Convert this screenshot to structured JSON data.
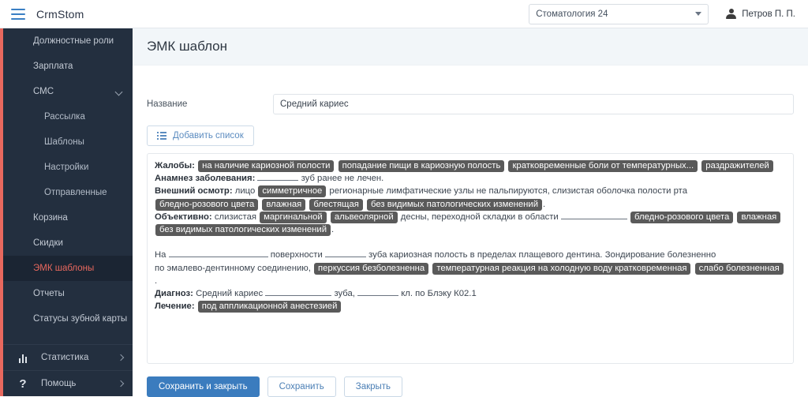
{
  "topbar": {
    "menu_icon": "hamburger-icon",
    "brand": "CrmStom",
    "clinic": {
      "selected": "Стоматология 24",
      "caret_icon": "chevron-down-icon"
    },
    "user": {
      "icon": "user-avatar-icon",
      "name": "Петров П. П."
    }
  },
  "sidebar": {
    "accent_color": "#e8685e",
    "background_color": "#232f3f",
    "items": [
      {
        "label": "Должностные роли",
        "sub": false,
        "active": false,
        "expandable": false
      },
      {
        "label": "Зарплата",
        "sub": false,
        "active": false,
        "expandable": false
      },
      {
        "label": "СМС",
        "sub": false,
        "active": false,
        "expandable": true
      },
      {
        "label": "Рассылка",
        "sub": true,
        "active": false,
        "expandable": false
      },
      {
        "label": "Шаблоны",
        "sub": true,
        "active": false,
        "expandable": false
      },
      {
        "label": "Настройки",
        "sub": true,
        "active": false,
        "expandable": false
      },
      {
        "label": "Отправленные",
        "sub": true,
        "active": false,
        "expandable": false
      },
      {
        "label": "Корзина",
        "sub": false,
        "active": false,
        "expandable": false
      },
      {
        "label": "Скидки",
        "sub": false,
        "active": false,
        "expandable": false
      },
      {
        "label": "ЭМК шаблоны",
        "sub": false,
        "active": true,
        "expandable": false
      },
      {
        "label": "Отчеты",
        "sub": false,
        "active": false,
        "expandable": false
      },
      {
        "label": "Статусы зубной карты",
        "sub": false,
        "active": false,
        "expandable": false
      }
    ],
    "footer_items": [
      {
        "label": "Статистика",
        "icon": "bar-chart-icon",
        "arrow_icon": "chevron-right-icon"
      },
      {
        "label": "Помощь",
        "icon": "question-mark-icon",
        "arrow_icon": "chevron-right-icon"
      }
    ]
  },
  "main": {
    "page_title": "ЭМК шаблон",
    "form": {
      "name_label": "Название",
      "name_value": "Средний кариес",
      "name_placeholder": ""
    },
    "add_list_button": {
      "label": "Добавить список",
      "icon": "list-icon"
    },
    "editor": {
      "lines": [
        {
          "id": "zhaloby",
          "parts": [
            {
              "type": "bold",
              "text": "Жалобы:"
            },
            {
              "type": "tag",
              "text": "на наличие кариозной полости"
            },
            {
              "type": "tag",
              "text": "попадание пищи в кариозную полость"
            },
            {
              "type": "tag",
              "text": "кратковременные боли от температурных..."
            },
            {
              "type": "tag",
              "text": "раздражителей"
            }
          ]
        },
        {
          "id": "anamnez",
          "parts": [
            {
              "type": "bold",
              "text": "Анамнез заболевания:"
            },
            {
              "type": "blank",
              "size": "md"
            },
            {
              "type": "text",
              "text": "зуб ранее не лечен."
            }
          ]
        },
        {
          "id": "vneshniy-osmotr",
          "parts": [
            {
              "type": "bold",
              "text": "Внешний осмотр:"
            },
            {
              "type": "text",
              "text": "лицо"
            },
            {
              "type": "tag",
              "text": "симметричное"
            },
            {
              "type": "text",
              "text": "регионарные лимфатические узлы не пальпируются, слизистая оболочка полости рта"
            },
            {
              "type": "tag",
              "text": "бледно-розового цвета"
            },
            {
              "type": "tag",
              "text": "влажная"
            },
            {
              "type": "tag",
              "text": "блестящая"
            },
            {
              "type": "tag",
              "text": "без видимых патологических изменений"
            },
            {
              "type": "text",
              "text": "."
            }
          ]
        },
        {
          "id": "obektivno",
          "parts": [
            {
              "type": "bold",
              "text": "Объективно:"
            },
            {
              "type": "text",
              "text": "слизистая"
            },
            {
              "type": "tag",
              "text": "маргинальной"
            },
            {
              "type": "tag",
              "text": "альвеолярной"
            },
            {
              "type": "text",
              "text": "десны, переходной складки в области"
            },
            {
              "type": "blank",
              "size": "lg"
            },
            {
              "type": "tag",
              "text": "бледно-розового цвета"
            },
            {
              "type": "tag",
              "text": "влажная"
            },
            {
              "type": "tag",
              "text": "без видимых патологических изменений"
            },
            {
              "type": "text",
              "text": "."
            }
          ]
        },
        {
          "id": "na-poverhnosti",
          "parts": [
            {
              "type": "text",
              "text": "На"
            },
            {
              "type": "blank",
              "size": "xl"
            },
            {
              "type": "text",
              "text": "поверхности"
            },
            {
              "type": "blank",
              "size": "md"
            },
            {
              "type": "text",
              "text": "зуба кариозная полость в пределах плащевого дентина. Зондирование болезненно"
            }
          ]
        },
        {
          "id": "po-emalevo",
          "parts": [
            {
              "type": "text",
              "text": "по эмалево-дентинному соединению,"
            },
            {
              "type": "tag",
              "text": "перкуссия безболезненна"
            },
            {
              "type": "tag",
              "text": "температурная реакция на холодную воду кратковременная"
            },
            {
              "type": "tag",
              "text": "слабо болезненная"
            },
            {
              "type": "text",
              "text": "."
            }
          ]
        },
        {
          "id": "diagnoz",
          "parts": [
            {
              "type": "bold",
              "text": "Диагноз:"
            },
            {
              "type": "text",
              "text": "Средний кариес"
            },
            {
              "type": "blank",
              "size": "lg"
            },
            {
              "type": "text",
              "text": "зуба,"
            },
            {
              "type": "blank",
              "size": "md"
            },
            {
              "type": "text",
              "text": "кл. по Блэку К02.1"
            }
          ]
        },
        {
          "id": "lechenie",
          "parts": [
            {
              "type": "bold",
              "text": "Лечение:"
            },
            {
              "type": "tag",
              "text": "под аппликационной анестезией"
            }
          ]
        }
      ]
    },
    "footer_buttons": [
      {
        "label": "Сохранить и закрыть",
        "style": "primary"
      },
      {
        "label": "Сохранить",
        "style": "outline"
      },
      {
        "label": "Закрыть",
        "style": "outline"
      }
    ]
  }
}
